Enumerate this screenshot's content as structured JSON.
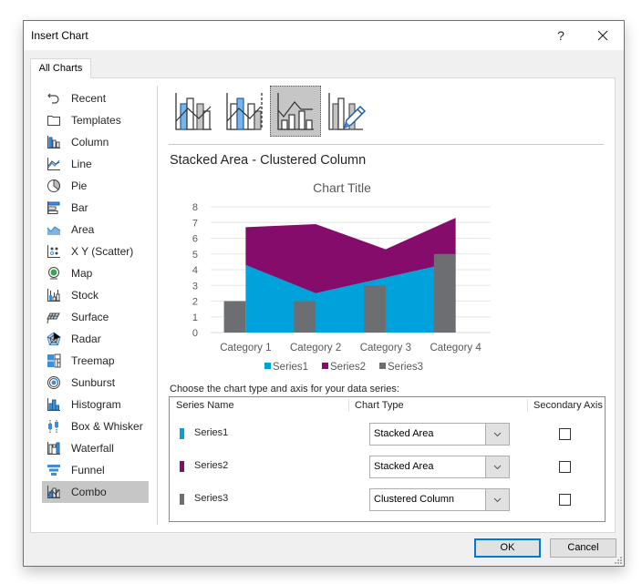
{
  "window": {
    "title": "Insert Chart",
    "help_label": "?",
    "close_label": "✕"
  },
  "tabs": [
    {
      "label": "All Charts",
      "active": true
    }
  ],
  "sidebar": {
    "items": [
      {
        "label": "Recent",
        "icon": "recent-icon"
      },
      {
        "label": "Templates",
        "icon": "templates-icon"
      },
      {
        "label": "Column",
        "icon": "column-chart-icon"
      },
      {
        "label": "Line",
        "icon": "line-chart-icon"
      },
      {
        "label": "Pie",
        "icon": "pie-chart-icon"
      },
      {
        "label": "Bar",
        "icon": "bar-chart-icon"
      },
      {
        "label": "Area",
        "icon": "area-chart-icon"
      },
      {
        "label": "X Y (Scatter)",
        "icon": "scatter-chart-icon"
      },
      {
        "label": "Map",
        "icon": "map-chart-icon"
      },
      {
        "label": "Stock",
        "icon": "stock-chart-icon"
      },
      {
        "label": "Surface",
        "icon": "surface-chart-icon"
      },
      {
        "label": "Radar",
        "icon": "radar-chart-icon"
      },
      {
        "label": "Treemap",
        "icon": "treemap-chart-icon"
      },
      {
        "label": "Sunburst",
        "icon": "sunburst-chart-icon"
      },
      {
        "label": "Histogram",
        "icon": "histogram-chart-icon"
      },
      {
        "label": "Box & Whisker",
        "icon": "box-whisker-chart-icon"
      },
      {
        "label": "Waterfall",
        "icon": "waterfall-chart-icon"
      },
      {
        "label": "Funnel",
        "icon": "funnel-chart-icon"
      },
      {
        "label": "Combo",
        "icon": "combo-chart-icon",
        "selected": true
      }
    ]
  },
  "gallery": {
    "items": [
      {
        "name": "clustered-column-line",
        "icon": "combo-column-line-icon"
      },
      {
        "name": "clustered-column-line-secondary-axis",
        "icon": "combo-column-line-secondary-icon"
      },
      {
        "name": "stacked-area-clustered-column",
        "icon": "combo-area-column-icon",
        "selected": true
      },
      {
        "name": "custom-combination",
        "icon": "custom-combo-pencil-icon"
      }
    ],
    "selected_title": "Stacked Area - Clustered Column"
  },
  "colors": {
    "series1": "#00a2dc",
    "series2": "#850c6b",
    "series3": "#6d6e71",
    "accent": "#0078d7",
    "gridline": "#e6e6e6"
  },
  "chart_data": {
    "type": "combo",
    "title": "Chart Title",
    "categories": [
      "Category 1",
      "Category 2",
      "Category 3",
      "Category 4"
    ],
    "series": [
      {
        "name": "Series1",
        "chart_type": "stacked-area",
        "values": [
          4.3,
          2.5,
          3.5,
          4.5
        ]
      },
      {
        "name": "Series2",
        "chart_type": "stacked-area",
        "values": [
          2.4,
          4.4,
          1.8,
          2.8
        ]
      },
      {
        "name": "Series3",
        "chart_type": "clustered-column",
        "values": [
          2,
          2,
          3,
          5
        ]
      }
    ],
    "y_ticks": [
      "0",
      "1",
      "2",
      "3",
      "4",
      "5",
      "6",
      "7",
      "8"
    ],
    "ylim": [
      0,
      8
    ],
    "xlabel": "",
    "ylabel": "",
    "grid": true,
    "legend_position": "bottom"
  },
  "series_config": {
    "prompt": "Choose the chart type and axis for your data series:",
    "headers": {
      "name": "Series Name",
      "type": "Chart Type",
      "secondary": "Secondary Axis"
    },
    "rows": [
      {
        "name": "Series1",
        "chart_type": "Stacked Area",
        "secondary_axis": false
      },
      {
        "name": "Series2",
        "chart_type": "Stacked Area",
        "secondary_axis": false
      },
      {
        "name": "Series3",
        "chart_type": "Clustered Column",
        "secondary_axis": false
      }
    ]
  },
  "footer": {
    "ok_label": "OK",
    "cancel_label": "Cancel"
  }
}
